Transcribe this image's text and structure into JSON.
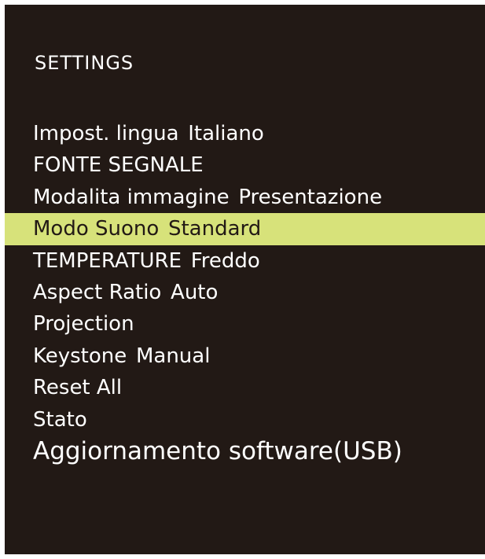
{
  "menu": {
    "title": "SETTINGS",
    "items": [
      {
        "label": "Impost. lingua",
        "value": "Italiano"
      },
      {
        "label": "FONTE SEGNALE",
        "value": ""
      },
      {
        "label": "Modalita immagine",
        "value": "Presentazione"
      },
      {
        "label": "Modo Suono",
        "value": "Standard"
      },
      {
        "label": "TEMPERATURE",
        "value": "Freddo"
      },
      {
        "label": "Aspect Ratio",
        "value": "Auto"
      },
      {
        "label": "Projection",
        "value": ""
      },
      {
        "label": "Keystone",
        "value": "Manual"
      },
      {
        "label": "Reset All",
        "value": ""
      },
      {
        "label": "Stato",
        "value": ""
      },
      {
        "label": "Aggiornamento software(USB)",
        "value": ""
      }
    ],
    "selected_index": 3
  },
  "colors": {
    "background": "#221915",
    "text": "#ffffff",
    "highlight": "#d7e27a",
    "highlight_text": "#221915"
  }
}
